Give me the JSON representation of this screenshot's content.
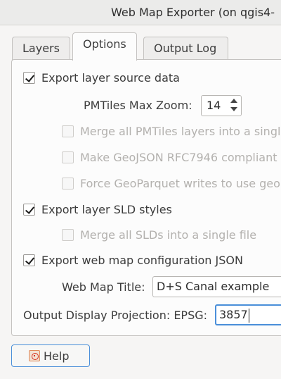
{
  "window": {
    "title": "Web Map Exporter (on qgis4-"
  },
  "tabs": [
    {
      "label": "Layers",
      "active": false
    },
    {
      "label": "Options",
      "active": true
    },
    {
      "label": "Output Log",
      "active": false
    }
  ],
  "options": {
    "export_source": {
      "label": "Export layer source data",
      "checked": true
    },
    "pmtiles_zoom": {
      "label": "PMTiles Max Zoom:",
      "value": "14"
    },
    "merge_pmtiles": {
      "label": "Merge all PMTiles layers into a singl",
      "checked": false,
      "enabled": false
    },
    "geojson_rfc": {
      "label": "Make GeoJSON RFC7946 compliant",
      "checked": false,
      "enabled": false
    },
    "geoparquet": {
      "label": "Force GeoParquet writes to use geo",
      "checked": false,
      "enabled": false
    },
    "export_sld": {
      "label": "Export layer SLD styles",
      "checked": true
    },
    "merge_sld": {
      "label": "Merge all SLDs into a single file",
      "checked": false,
      "enabled": false
    },
    "export_config": {
      "label": "Export web map configuration JSON",
      "checked": true
    },
    "web_map_title": {
      "label": "Web Map Title:",
      "value": "D+S Canal example"
    },
    "projection": {
      "label": "Output Display Projection: EPSG:",
      "value": "3857"
    }
  },
  "footer": {
    "help_label": "Help"
  },
  "colors": {
    "focus": "#4a8fd9",
    "panel": "#fcfcfc",
    "window": "#f6f5f4"
  }
}
